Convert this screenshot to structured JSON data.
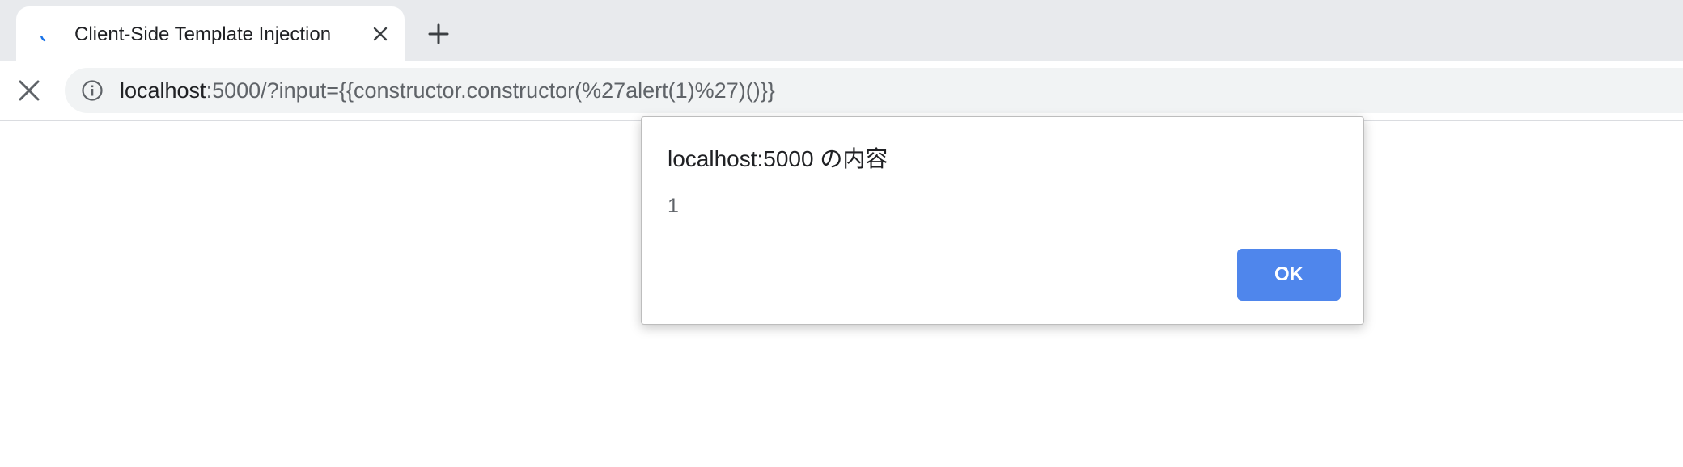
{
  "browser": {
    "tab": {
      "title": "Client-Side Template Injection",
      "close_icon": "close-icon",
      "loading_icon": "loading-spinner-icon"
    },
    "new_tab_icon": "plus-icon",
    "toolbar": {
      "stop_icon": "close-icon",
      "site_info_icon": "info-icon",
      "url_host": "localhost",
      "url_rest": ":5000/?input={{constructor.constructor(%27alert(1)%27)()}}"
    }
  },
  "dialog": {
    "title": "localhost:5000 の内容",
    "message": "1",
    "ok_label": "OK",
    "accent_color": "#4f86ec"
  }
}
